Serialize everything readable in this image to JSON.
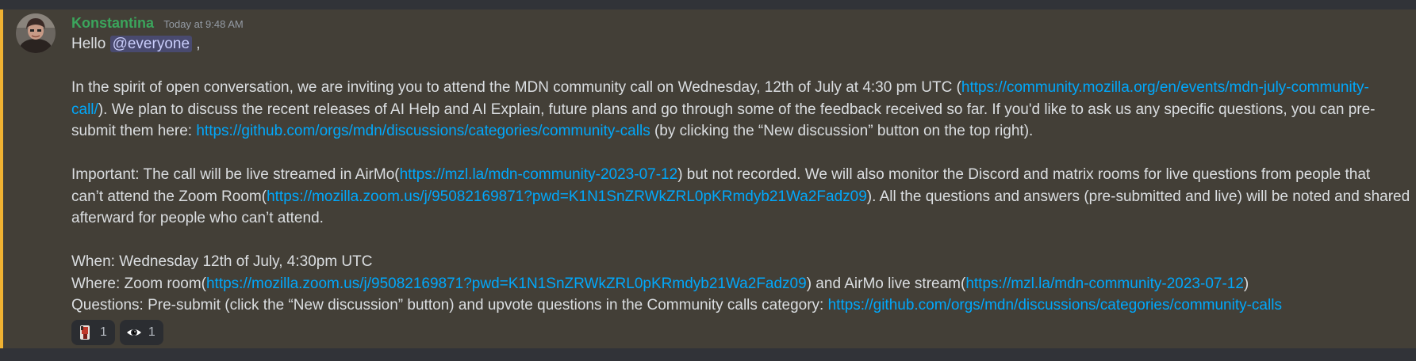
{
  "message": {
    "author": "Konstantina",
    "timestamp": "Today at 9:48 AM",
    "greeting": {
      "text": "Hello ",
      "mention": "@everyone",
      "after": " ,"
    },
    "p1": {
      "l1_text": "In the spirit of open conversation, we are inviting you to attend the MDN community call on Wednesday, 12th of July at 4:30 pm UTC (",
      "l1_link": "https://community.mozilla.org/en/events/mdn-july-community-",
      "l2_link": "call/",
      "l2_text": "). We plan to discuss the recent releases of AI Help and AI Explain, future plans and go through some of the feedback received so far. If you'd like to ask us any specific questions, you can pre-",
      "l3_text": "submit them here: ",
      "l3_link": "https://github.com/orgs/mdn/discussions/categories/community-calls",
      "l3_after": " (by clicking the “New discussion” button on the top right)."
    },
    "p2": {
      "l1_text": "Important: The call will be live streamed in AirMo(",
      "l1_link": "https://mzl.la/mdn-community-2023-07-12",
      "l1_after": ") but not recorded. We will also monitor the Discord and matrix rooms for live questions from people that",
      "l2_text": "can’t attend the Zoom Room(",
      "l2_link": "https://mozilla.zoom.us/j/95082169871?pwd=K1N1SnZRWkZRL0pKRmdyb21Wa2Fadz09",
      "l2_after": "). All the questions and answers (pre-submitted and live) will be noted and shared",
      "l3_text": "afterward for people who can’t attend."
    },
    "p3": {
      "when": "When: Wednesday 12th of July, 4:30pm UTC",
      "where_text": "Where: Zoom room(",
      "where_link1": "https://mozilla.zoom.us/j/95082169871?pwd=K1N1SnZRWkZRL0pKRmdyb21Wa2Fadz09",
      "where_mid": ") and AirMo live stream(",
      "where_link2": "https://mzl.la/mdn-community-2023-07-12",
      "where_after": ")",
      "questions_text": "Questions: Pre-submit (click the “New discussion” button) and upvote questions in the Community calls category: ",
      "questions_link": "https://github.com/orgs/mdn/discussions/categories/community-calls"
    },
    "reactions": [
      {
        "emoji": "custom-avatar-emoji",
        "count": "1"
      },
      {
        "emoji": "eye-icon",
        "count": "1"
      }
    ]
  },
  "colors": {
    "background": "#313338",
    "mention_highlight": "#433f37",
    "mention_bar": "#f0b232",
    "username": "#3ba55c",
    "link": "#00a8fc",
    "text": "#dbdee1"
  }
}
